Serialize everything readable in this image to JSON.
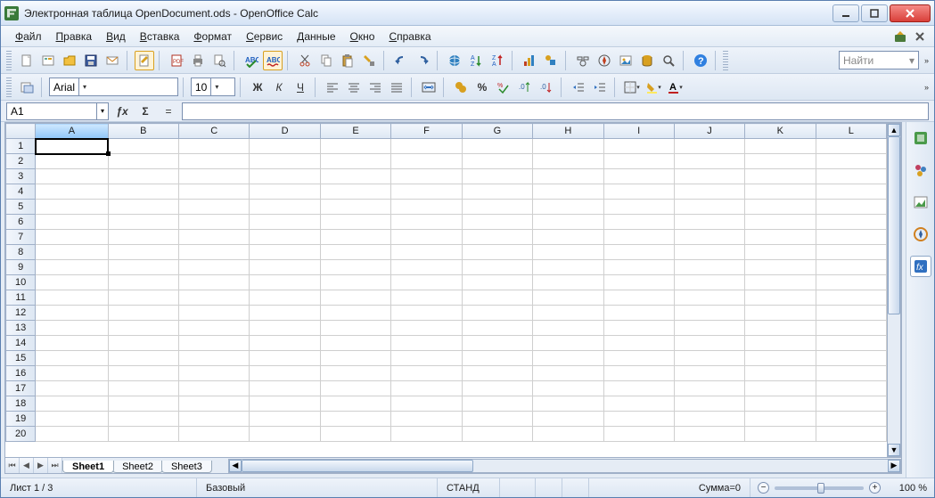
{
  "window": {
    "title": "Электронная таблица OpenDocument.ods - OpenOffice Calc"
  },
  "menu": {
    "items": [
      {
        "u": "Ф",
        "rest": "айл"
      },
      {
        "u": "П",
        "rest": "равка"
      },
      {
        "u": "В",
        "rest": "ид"
      },
      {
        "u": "В",
        "rest": "ставка"
      },
      {
        "u": "Ф",
        "rest": "ормат"
      },
      {
        "u": "С",
        "rest": "ервис"
      },
      {
        "u": "Д",
        "rest": "анные"
      },
      {
        "u": "О",
        "rest": "кно"
      },
      {
        "u": "С",
        "rest": "правка"
      }
    ]
  },
  "toolbar": {
    "find_placeholder": "Найти"
  },
  "format": {
    "font": "Arial",
    "size": "10",
    "bold": "Ж",
    "italic": "К",
    "underline": "Ч"
  },
  "formula": {
    "cell_ref": "A1",
    "sigma": "Σ",
    "equals": "="
  },
  "columns": [
    "A",
    "B",
    "C",
    "D",
    "E",
    "F",
    "G",
    "H",
    "I",
    "J",
    "K",
    "L"
  ],
  "rows_visible": 20,
  "active_col": 0,
  "active_row": 0,
  "sheets": {
    "tabs": [
      "Sheet1",
      "Sheet2",
      "Sheet3"
    ],
    "active": 0
  },
  "status": {
    "page": "Лист 1 / 3",
    "style": "Базовый",
    "mode": "СТАНД",
    "sum": "Сумма=0",
    "zoom": "100 %"
  },
  "icons": {
    "fx": "ƒx"
  }
}
